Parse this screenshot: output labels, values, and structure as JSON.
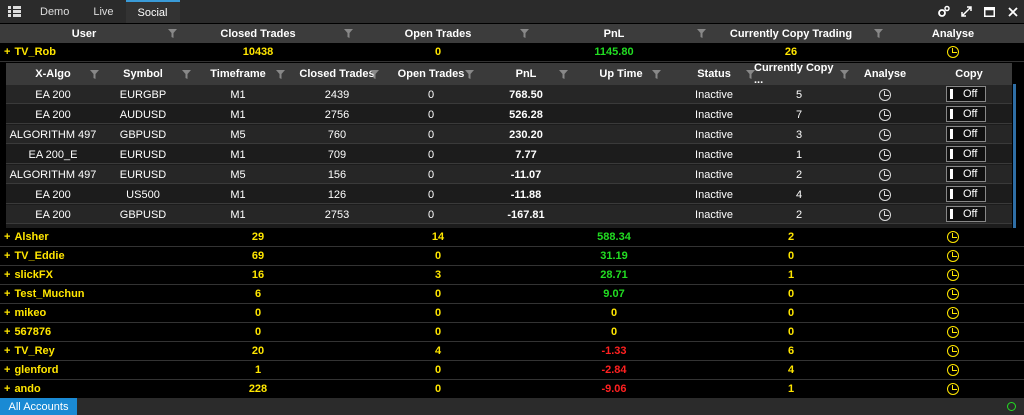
{
  "tabs": [
    {
      "label": "Demo"
    },
    {
      "label": "Live"
    },
    {
      "label": "Social"
    }
  ],
  "outer_headers": [
    "User",
    "Closed Trades",
    "Open Trades",
    "PnL",
    "Currently Copy Trading",
    "Analyse"
  ],
  "expanded_user": {
    "name": "TV_Rob",
    "closed": "10438",
    "open": "0",
    "pnl": "1145.80",
    "copying": "26"
  },
  "inner_headers": [
    "X-Algo",
    "Symbol",
    "Timeframe",
    "Closed Trades",
    "Open Trades",
    "PnL",
    "Up Time",
    "Status",
    "Currently Copy ...",
    "Analyse",
    "Copy"
  ],
  "algos": [
    {
      "algo": "EA 200",
      "symbol": "EURGBP",
      "tf": "M1",
      "closed": "2439",
      "open": "0",
      "pnl": "768.50",
      "pnl_color": "green",
      "status": "Inactive",
      "copying": "5",
      "copy": "Off"
    },
    {
      "algo": "EA 200",
      "symbol": "AUDUSD",
      "tf": "M1",
      "closed": "2756",
      "open": "0",
      "pnl": "526.28",
      "pnl_color": "green",
      "status": "Inactive",
      "copying": "7",
      "copy": "Off"
    },
    {
      "algo": "ALGORITHM 497",
      "symbol": "GBPUSD",
      "tf": "M5",
      "closed": "760",
      "open": "0",
      "pnl": "230.20",
      "pnl_color": "green",
      "status": "Inactive",
      "copying": "3",
      "copy": "Off"
    },
    {
      "algo": "EA 200_E",
      "symbol": "EURUSD",
      "tf": "M1",
      "closed": "709",
      "open": "0",
      "pnl": "7.77",
      "pnl_color": "green",
      "status": "Inactive",
      "copying": "1",
      "copy": "Off"
    },
    {
      "algo": "ALGORITHM 497",
      "symbol": "EURUSD",
      "tf": "M5",
      "closed": "156",
      "open": "0",
      "pnl": "-11.07",
      "pnl_color": "red",
      "status": "Inactive",
      "copying": "2",
      "copy": "Off"
    },
    {
      "algo": "EA 200",
      "symbol": "US500",
      "tf": "M1",
      "closed": "126",
      "open": "0",
      "pnl": "-11.88",
      "pnl_color": "red",
      "status": "Inactive",
      "copying": "4",
      "copy": "Off"
    },
    {
      "algo": "EA 200",
      "symbol": "GBPUSD",
      "tf": "M1",
      "closed": "2753",
      "open": "0",
      "pnl": "-167.81",
      "pnl_color": "red",
      "status": "Inactive",
      "copying": "2",
      "copy": "Off"
    }
  ],
  "users": [
    {
      "name": "Alsher",
      "closed": "29",
      "open": "14",
      "pnl": "588.34",
      "pnl_color": "green",
      "copying": "2"
    },
    {
      "name": "TV_Eddie",
      "closed": "69",
      "open": "0",
      "pnl": "31.19",
      "pnl_color": "green",
      "copying": "0"
    },
    {
      "name": "slickFX",
      "closed": "16",
      "open": "3",
      "pnl": "28.71",
      "pnl_color": "green",
      "copying": "1"
    },
    {
      "name": "Test_Muchun",
      "closed": "6",
      "open": "0",
      "pnl": "9.07",
      "pnl_color": "green",
      "copying": "0"
    },
    {
      "name": "mikeo",
      "closed": "0",
      "open": "0",
      "pnl": "0",
      "pnl_color": "yellow",
      "copying": "0"
    },
    {
      "name": "567876",
      "closed": "0",
      "open": "0",
      "pnl": "0",
      "pnl_color": "yellow",
      "copying": "0"
    },
    {
      "name": "TV_Rey",
      "closed": "20",
      "open": "4",
      "pnl": "-1.33",
      "pnl_color": "red",
      "copying": "6"
    },
    {
      "name": "glenford",
      "closed": "1",
      "open": "0",
      "pnl": "-2.84",
      "pnl_color": "red",
      "copying": "4"
    },
    {
      "name": "ando",
      "closed": "228",
      "open": "0",
      "pnl": "-9.06",
      "pnl_color": "red",
      "copying": "1"
    }
  ],
  "statusbar": {
    "tab": "All Accounts"
  },
  "colors": {
    "accent": "#1a8ad4",
    "positive": "#22dd22",
    "negative": "#ff2020",
    "user": "#ffe600"
  }
}
